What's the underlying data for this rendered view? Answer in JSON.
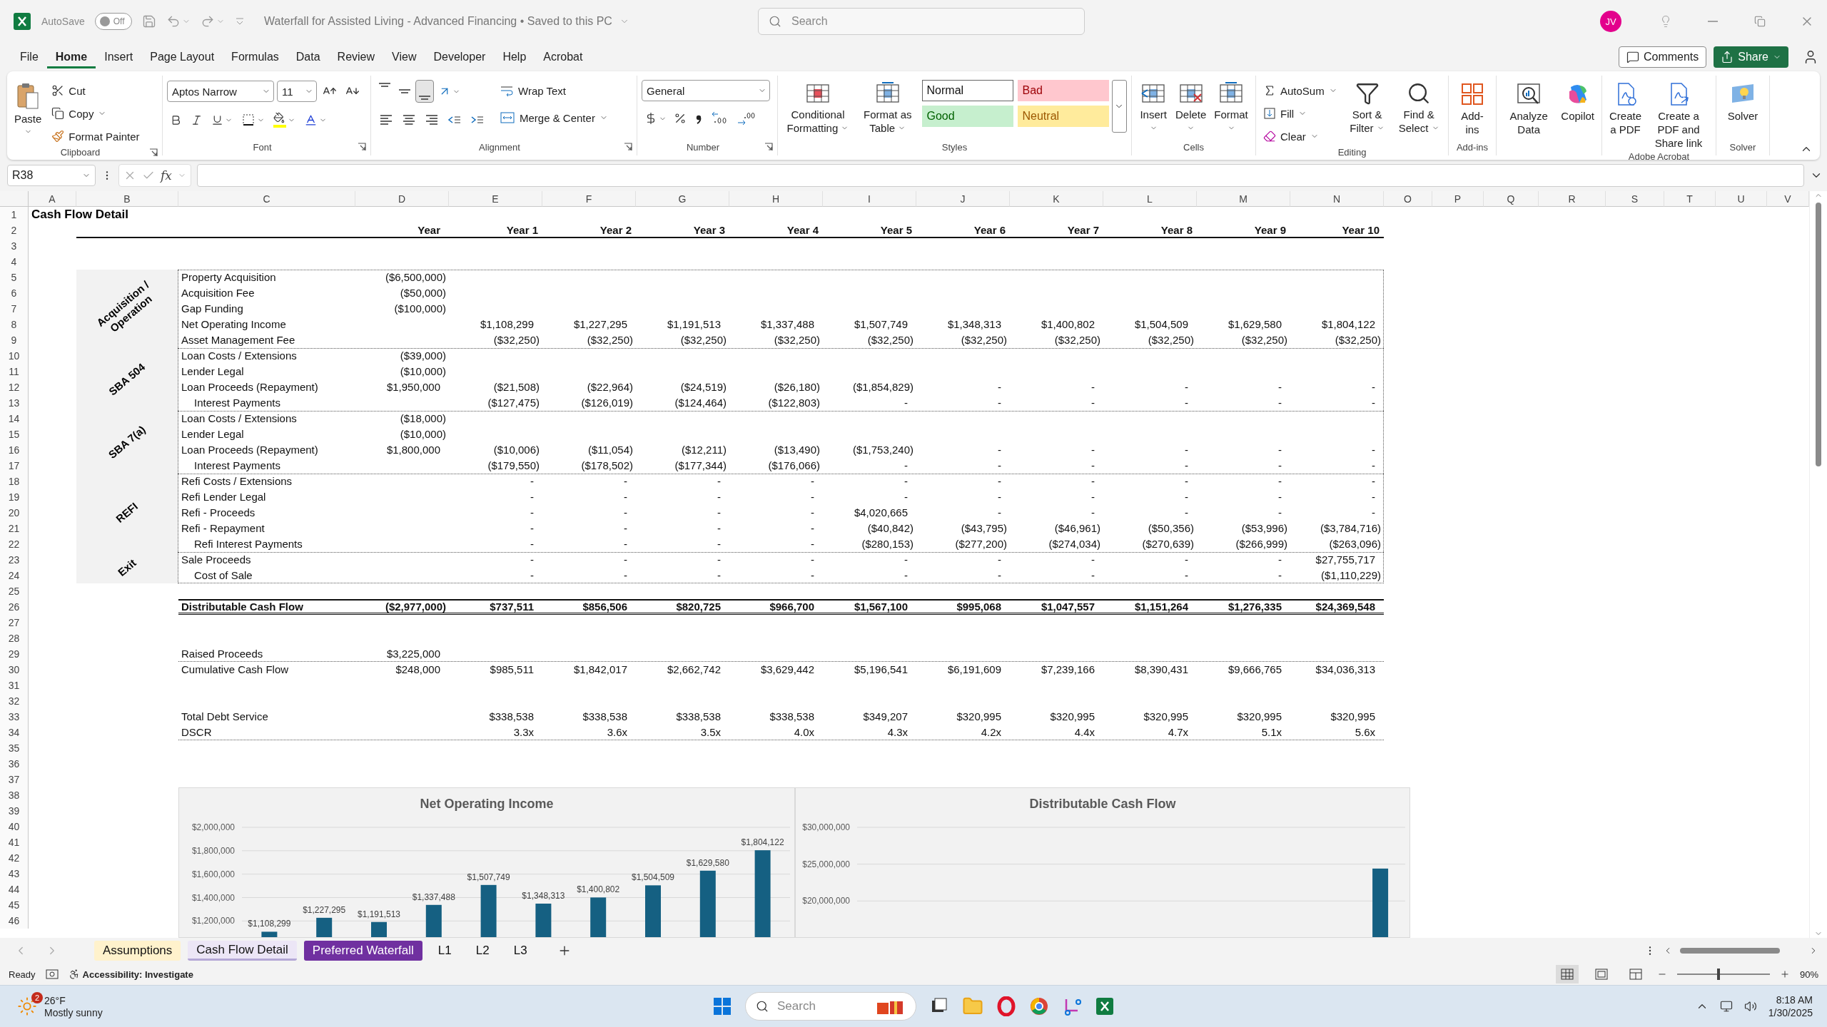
{
  "titlebar": {
    "autosave_label": "AutoSave",
    "autosave": {
      "on": false,
      "text": "Off"
    },
    "title": "Waterfall for Assisted Living - Advanced Financing • Saved to this PC",
    "search_placeholder": "Search",
    "avatar": "JV"
  },
  "menu": {
    "tabs": [
      {
        "label": "File",
        "selected": false
      },
      {
        "label": "Home",
        "selected": true
      },
      {
        "label": "Insert",
        "selected": false
      },
      {
        "label": "Page Layout",
        "selected": false
      },
      {
        "label": "Formulas",
        "selected": false
      },
      {
        "label": "Data",
        "selected": false
      },
      {
        "label": "Review",
        "selected": false
      },
      {
        "label": "View",
        "selected": false
      },
      {
        "label": "Developer",
        "selected": false
      },
      {
        "label": "Help",
        "selected": false
      },
      {
        "label": "Acrobat",
        "selected": false
      }
    ],
    "comments": "Comments",
    "share": "Share"
  },
  "ribbon": {
    "groups": [
      {
        "kind": "clipboard",
        "label": "Clipboard",
        "paste": "Paste",
        "cut": "Cut",
        "copy": "Copy",
        "format_painter": "Format Painter"
      },
      {
        "kind": "font",
        "label": "Font",
        "font_name": "Aptos Narrow",
        "font_size": "11"
      },
      {
        "kind": "alignment",
        "label": "Alignment",
        "wrap_text": "Wrap Text",
        "merge": "Merge & Center",
        "vertical_align": [
          {
            "selected": false
          },
          {
            "selected": false
          },
          {
            "selected": true
          }
        ]
      },
      {
        "kind": "number",
        "label": "Number",
        "format": "General"
      },
      {
        "kind": "styles",
        "label": "Styles",
        "buttons": [
          {
            "label": "Conditional Formatting",
            "menu": true
          },
          {
            "label": "Format as Table",
            "menu": true
          }
        ],
        "styles": [
          {
            "label": "Normal",
            "color": "#ffffff"
          },
          {
            "label": "Bad",
            "color": "#ffc7ce"
          },
          {
            "label": "Good",
            "color": "#c6efce"
          },
          {
            "label": "Neutral",
            "color": "#ffeb9c"
          }
        ]
      },
      {
        "kind": "cells",
        "label": "Cells",
        "buttons": [
          {
            "label": "Insert",
            "menu": true
          },
          {
            "label": "Delete",
            "menu": true
          },
          {
            "label": "Format",
            "menu": true
          }
        ]
      },
      {
        "kind": "editing",
        "label": "Editing",
        "autosum": "AutoSum",
        "fill": "Fill",
        "clear": "Clear",
        "buttons": [
          {
            "label": "Sort & Filter",
            "menu": true
          },
          {
            "label": "Find & Select",
            "menu": true
          }
        ]
      },
      {
        "kind": "buttons",
        "label": "Add-ins",
        "buttons": [
          {
            "label": "Add-ins",
            "menu": false
          }
        ]
      },
      {
        "kind": "buttons",
        "buttons": [
          {
            "label": "Analyze Data",
            "menu": false
          },
          {
            "label": "Copilot",
            "menu": false
          }
        ]
      },
      {
        "kind": "buttons",
        "label": "Adobe Acrobat",
        "buttons": [
          {
            "label": "Create a PDF",
            "menu": false
          },
          {
            "label": "Create a PDF and Share link",
            "menu": false
          }
        ]
      },
      {
        "kind": "buttons",
        "label": "Solver",
        "buttons": [
          {
            "label": "Solver",
            "menu": false
          }
        ]
      }
    ]
  },
  "formula_bar": {
    "name_box": "R38",
    "function_label": "fx"
  },
  "sheet": {
    "columns": [
      "A",
      "B",
      "C",
      "D",
      "E",
      "F",
      "G",
      "H",
      "I",
      "J",
      "K",
      "L",
      "M",
      "N",
      "O",
      "P",
      "Q",
      "R",
      "S",
      "T",
      "U",
      "V"
    ],
    "row_numbers": [
      "1",
      "2",
      "3",
      "4",
      "5",
      "6",
      "7",
      "8",
      "9",
      "10",
      "11",
      "12",
      "13",
      "14",
      "15",
      "16",
      "17",
      "18",
      "19",
      "20",
      "21",
      "22",
      "23",
      "24",
      "25",
      "26",
      "27",
      "28",
      "29",
      "30",
      "31",
      "32",
      "33",
      "34",
      "35",
      "36",
      "37",
      "38",
      "39",
      "40",
      "41",
      "42",
      "43",
      "44",
      "45",
      "46"
    ],
    "title": "Cash Flow Detail",
    "header": {
      "label": "Year",
      "years": [
        "Year 1",
        "Year 2",
        "Year 3",
        "Year 4",
        "Year 5",
        "Year 6",
        "Year 7",
        "Year 8",
        "Year 9",
        "Year 10"
      ]
    },
    "sections": [
      {
        "label": "Acquisition / Operation",
        "rows": [
          {
            "label": "Property Acquisition",
            "indented": false,
            "cells": {
              "D": "($6,500,000)"
            }
          },
          {
            "label": "Acquisition Fee",
            "indented": false,
            "cells": {
              "D": "($50,000)"
            }
          },
          {
            "label": "Gap Funding",
            "indented": false,
            "cells": {
              "D": "($100,000)"
            }
          },
          {
            "label": "Net Operating Income",
            "indented": false,
            "cells": {
              "E": "$1,108,299",
              "F": "$1,227,295",
              "G": "$1,191,513",
              "H": "$1,337,488",
              "I": "$1,507,749",
              "J": "$1,348,313",
              "K": "$1,400,802",
              "L": "$1,504,509",
              "M": "$1,629,580",
              "N": "$1,804,122"
            }
          },
          {
            "label": "Asset Management Fee",
            "indented": false,
            "cells": {
              "E": "($32,250)",
              "F": "($32,250)",
              "G": "($32,250)",
              "H": "($32,250)",
              "I": "($32,250)",
              "J": "($32,250)",
              "K": "($32,250)",
              "L": "($32,250)",
              "M": "($32,250)",
              "N": "($32,250)"
            }
          }
        ]
      },
      {
        "label": "SBA 504",
        "rows": [
          {
            "label": "Loan Costs / Extensions",
            "indented": false,
            "cells": {
              "D": "($39,000)"
            }
          },
          {
            "label": "Lender Legal",
            "indented": false,
            "cells": {
              "D": "($10,000)"
            }
          },
          {
            "label": "Loan Proceeds (Repayment)",
            "indented": false,
            "cells": {
              "D": "$1,950,000",
              "E": "($21,508)",
              "F": "($22,964)",
              "G": "($24,519)",
              "H": "($26,180)",
              "I": "($1,854,829)",
              "J": "-",
              "K": "-",
              "L": "-",
              "M": "-",
              "N": "-"
            }
          },
          {
            "label": "Interest Payments",
            "indented": true,
            "cells": {
              "E": "($127,475)",
              "F": "($126,019)",
              "G": "($124,464)",
              "H": "($122,803)",
              "I": "-",
              "J": "-",
              "K": "-",
              "L": "-",
              "M": "-",
              "N": "-"
            }
          }
        ]
      },
      {
        "label": "SBA 7(a)",
        "rows": [
          {
            "label": "Loan Costs / Extensions",
            "indented": false,
            "cells": {
              "D": "($18,000)"
            }
          },
          {
            "label": "Lender Legal",
            "indented": false,
            "cells": {
              "D": "($10,000)"
            }
          },
          {
            "label": "Loan Proceeds (Repayment)",
            "indented": false,
            "cells": {
              "D": "$1,800,000",
              "E": "($10,006)",
              "F": "($11,054)",
              "G": "($12,211)",
              "H": "($13,490)",
              "I": "($1,753,240)",
              "J": "-",
              "K": "-",
              "L": "-",
              "M": "-",
              "N": "-"
            }
          },
          {
            "label": "Interest Payments",
            "indented": true,
            "cells": {
              "E": "($179,550)",
              "F": "($178,502)",
              "G": "($177,344)",
              "H": "($176,066)",
              "I": "-",
              "J": "-",
              "K": "-",
              "L": "-",
              "M": "-",
              "N": "-"
            }
          }
        ]
      },
      {
        "label": "REFI",
        "rows": [
          {
            "label": "Refi Costs / Extensions",
            "indented": false,
            "cells": {
              "E": "-",
              "F": "-",
              "G": "-",
              "H": "-",
              "I": "-",
              "J": "-",
              "K": "-",
              "L": "-",
              "M": "-",
              "N": "-"
            }
          },
          {
            "label": "Refi Lender Legal",
            "indented": false,
            "cells": {
              "E": "-",
              "F": "-",
              "G": "-",
              "H": "-",
              "I": "-",
              "J": "-",
              "K": "-",
              "L": "-",
              "M": "-",
              "N": "-"
            }
          },
          {
            "label": "Refi - Proceeds",
            "indented": false,
            "cells": {
              "E": "-",
              "F": "-",
              "G": "-",
              "H": "-",
              "I": "$4,020,665",
              "J": "-",
              "K": "-",
              "L": "-",
              "M": "-",
              "N": "-"
            }
          },
          {
            "label": "Refi - Repayment",
            "indented": false,
            "cells": {
              "E": "-",
              "F": "-",
              "G": "-",
              "H": "-",
              "I": "($40,842)",
              "J": "($43,795)",
              "K": "($46,961)",
              "L": "($50,356)",
              "M": "($53,996)",
              "N": "($3,784,716)"
            }
          },
          {
            "label": "Refi Interest Payments",
            "indented": true,
            "cells": {
              "E": "-",
              "F": "-",
              "G": "-",
              "H": "-",
              "I": "($280,153)",
              "J": "($277,200)",
              "K": "($274,034)",
              "L": "($270,639)",
              "M": "($266,999)",
              "N": "($263,096)"
            }
          }
        ]
      },
      {
        "label": "Exit",
        "rows": [
          {
            "label": "Sale Proceeds",
            "indented": false,
            "cells": {
              "E": "-",
              "F": "-",
              "G": "-",
              "H": "-",
              "I": "-",
              "J": "-",
              "K": "-",
              "L": "-",
              "M": "-",
              "N": "$27,755,717"
            }
          },
          {
            "label": "Cost of Sale",
            "indented": true,
            "cells": {
              "E": "-",
              "F": "-",
              "G": "-",
              "H": "-",
              "I": "-",
              "J": "-",
              "K": "-",
              "L": "-",
              "M": "-",
              "N": "($1,110,229)"
            }
          }
        ]
      }
    ],
    "summary": [
      {
        "kind": "total",
        "label": "Distributable Cash Flow",
        "cells": {
          "D": "($2,977,000)",
          "E": "$737,511",
          "F": "$856,506",
          "G": "$820,725",
          "H": "$966,700",
          "I": "$1,567,100",
          "J": "$995,068",
          "K": "$1,047,557",
          "L": "$1,151,264",
          "M": "$1,276,335",
          "N": "$24,369,548"
        }
      },
      {
        "kind": "ruled",
        "label": "Raised Proceeds",
        "cells": {
          "D": "$3,225,000"
        }
      },
      {
        "kind": "plain",
        "label": "Cumulative Cash Flow",
        "cells": {
          "D": "$248,000",
          "E": "$985,511",
          "F": "$1,842,017",
          "G": "$2,662,742",
          "H": "$3,629,442",
          "I": "$5,196,541",
          "J": "$6,191,609",
          "K": "$7,239,166",
          "L": "$8,390,431",
          "M": "$9,666,765",
          "N": "$34,036,313"
        }
      },
      {
        "kind": "plain",
        "label": "Total Debt Service",
        "cells": {
          "E": "$338,538",
          "F": "$338,538",
          "G": "$338,538",
          "H": "$338,538",
          "I": "$349,207",
          "J": "$320,995",
          "K": "$320,995",
          "L": "$320,995",
          "M": "$320,995",
          "N": "$320,995"
        }
      },
      {
        "kind": "ruled",
        "label": "DSCR",
        "cells": {
          "E": "3.3x",
          "F": "3.6x",
          "G": "3.5x",
          "H": "4.0x",
          "I": "4.3x",
          "J": "4.2x",
          "K": "4.4x",
          "L": "4.7x",
          "M": "5.1x",
          "N": "5.6x"
        }
      }
    ],
    "charts": [
      {
        "chart_data": {
          "type": "bar",
          "title": "Net Operating Income",
          "values": [
            1108299,
            1227295,
            1191513,
            1337488,
            1507749,
            1348313,
            1400802,
            1504509,
            1629580,
            1804122
          ],
          "value_labels": [
            "$1,108,299",
            "$1,227,295",
            "$1,191,513",
            "$1,337,488",
            "$1,507,749",
            "$1,348,313",
            "$1,400,802",
            "$1,504,509",
            "$1,629,580",
            "$1,804,122"
          ],
          "ylim": [
            1050000,
            2000000
          ],
          "yticks": [
            {
              "value": 2000000,
              "label": "$2,000,000"
            },
            {
              "value": 1800000,
              "label": "$1,800,000"
            },
            {
              "value": 1600000,
              "label": "$1,600,000"
            },
            {
              "value": 1400000,
              "label": "$1,400,000"
            },
            {
              "value": 1200000,
              "label": "$1,200,000"
            }
          ],
          "grid": true
        }
      },
      {
        "chart_data": {
          "type": "bar",
          "title": "Distributable Cash Flow",
          "values": [
            null,
            null,
            null,
            null,
            null,
            null,
            null,
            null,
            null,
            null,
            24400000
          ],
          "ylim": [
            14900000,
            30000000
          ],
          "yticks": [
            {
              "value": 30000000,
              "label": "$30,000,000"
            },
            {
              "value": 25000000,
              "label": "$25,000,000"
            },
            {
              "value": 20000000,
              "label": "$20,000,000"
            }
          ],
          "grid": true
        }
      }
    ]
  },
  "sheet_tabs": [
    {
      "label": "Assumptions",
      "selected": false,
      "color": "#fff2cc"
    },
    {
      "label": "Cash Flow Detail",
      "selected": true,
      "color": "#b4a7d6"
    },
    {
      "label": "Preferred Waterfall",
      "selected": false,
      "color": "#7030a0"
    },
    {
      "label": "L1",
      "selected": false
    },
    {
      "label": "L2",
      "selected": false
    },
    {
      "label": "L3",
      "selected": false
    }
  ],
  "status": {
    "ready": "Ready",
    "accessibility": "Accessibility: Investigate",
    "views": [
      {
        "selected": true
      },
      {
        "selected": false
      },
      {
        "selected": false
      }
    ],
    "zoom": {
      "level": 0.45,
      "text": "90%"
    }
  },
  "taskbar": {
    "weather": {
      "badge": "2",
      "temp": "26°F",
      "condition": "Mostly sunny"
    },
    "search_placeholder": "Search",
    "time": "8:18 AM",
    "date": "1/30/2025"
  }
}
